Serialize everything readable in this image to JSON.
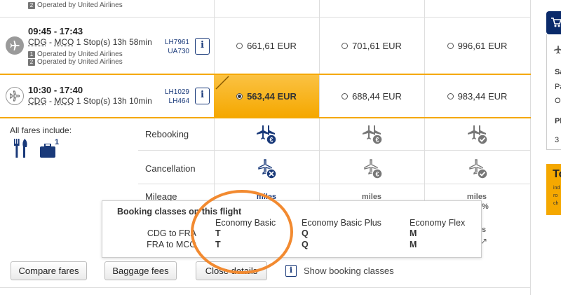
{
  "flights": [
    {
      "operated_by": "Operated by United Airlines",
      "op_num": "2"
    },
    {
      "times": "09:45 - 17:43",
      "origin": "CDG",
      "dest": "MCO",
      "stops_duration": "1 Stop(s)  13h 58min",
      "flight_codes": [
        "LH7961",
        "UA730"
      ],
      "operated": [
        {
          "num": "1",
          "text": "Operated by United Airlines"
        },
        {
          "num": "2",
          "text": "Operated by United Airlines"
        }
      ],
      "prices": [
        "661,61 EUR",
        "701,61 EUR",
        "996,61 EUR"
      ]
    },
    {
      "times": "10:30 - 17:40",
      "origin": "CDG",
      "dest": "MCO",
      "stops_duration": "1 Stop(s)  13h 10min",
      "flight_codes": [
        "LH1029",
        "LH464"
      ],
      "prices": [
        "563,44 EUR",
        "688,44 EUR",
        "983,44 EUR"
      ],
      "selected_index": 0
    }
  ],
  "fares": {
    "include_label": "All fares include:",
    "baggage_count": "1",
    "features": [
      "Rebooking",
      "Cancellation",
      "Mileage"
    ],
    "miles_label": "miles",
    "partial_pct": "%"
  },
  "booking_popup": {
    "title": "Booking classes on this flight",
    "routes": [
      "CDG to FRA",
      "FRA to MCO"
    ],
    "columns": [
      {
        "name": "Economy Basic",
        "classes": [
          "T",
          "T"
        ]
      },
      {
        "name": "Economy Basic Plus",
        "classes": [
          "Q",
          "Q"
        ]
      },
      {
        "name": "Economy Flex",
        "classes": [
          "M",
          "M"
        ]
      }
    ]
  },
  "buttons": {
    "compare": "Compare fares",
    "baggage": "Baggage fees",
    "close": "Close details",
    "show_classes": "Show booking classes"
  },
  "sidebar": {
    "summary_lines": [
      "Sa",
      "Pa",
      "O",
      "Pl",
      "3"
    ],
    "promo_title": "To",
    "promo_small": [
      "ind",
      "ro",
      "ch"
    ]
  },
  "colors": {
    "accent_yellow": "#f5a800",
    "brand_navy": "#1a3a7a",
    "annotation_orange": "#f28a30"
  }
}
